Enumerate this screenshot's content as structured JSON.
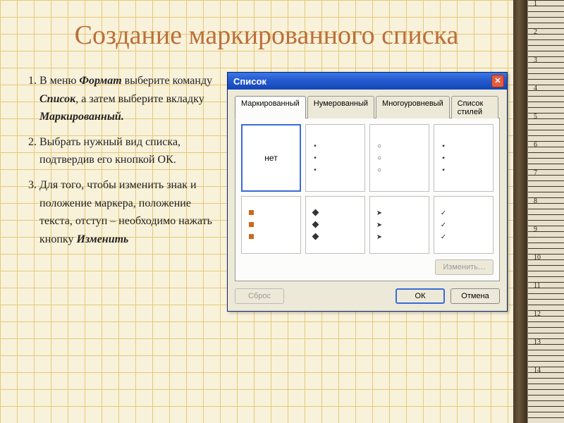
{
  "title": "Создание маркированного списка",
  "steps": [
    {
      "pre": "В меню ",
      "em1": "Формат",
      "mid": " выберите команду ",
      "em2": "Список",
      "post": ", а затем выберите вкладку ",
      "em3": "Маркированный.",
      "tail": ""
    },
    {
      "pre": "Выбрать нужный вид списка, подтвердив его кнопкой ОК.",
      "em1": "",
      "mid": "",
      "em2": "",
      "post": "",
      "em3": "",
      "tail": ""
    },
    {
      "pre": "Для того, чтобы изменить знак и положение маркера, положение текста, отступ – необходимо нажать кнопку ",
      "em1": "Изменить",
      "mid": "",
      "em2": "",
      "post": "",
      "em3": "",
      "tail": ""
    }
  ],
  "dialog": {
    "title": "Список",
    "tabs": [
      "Маркированный",
      "Нумерованный",
      "Многоуровневый",
      "Список стилей"
    ],
    "activeTab": 0,
    "none_label": "нет",
    "buttons": {
      "modify": "Изменить…",
      "reset": "Сброс",
      "ok": "ОК",
      "cancel": "Отмена"
    }
  },
  "ruler_nums": [
    "1",
    "2",
    "3",
    "4",
    "5",
    "6",
    "7",
    "8",
    "9",
    "10",
    "11",
    "12",
    "13",
    "14"
  ]
}
